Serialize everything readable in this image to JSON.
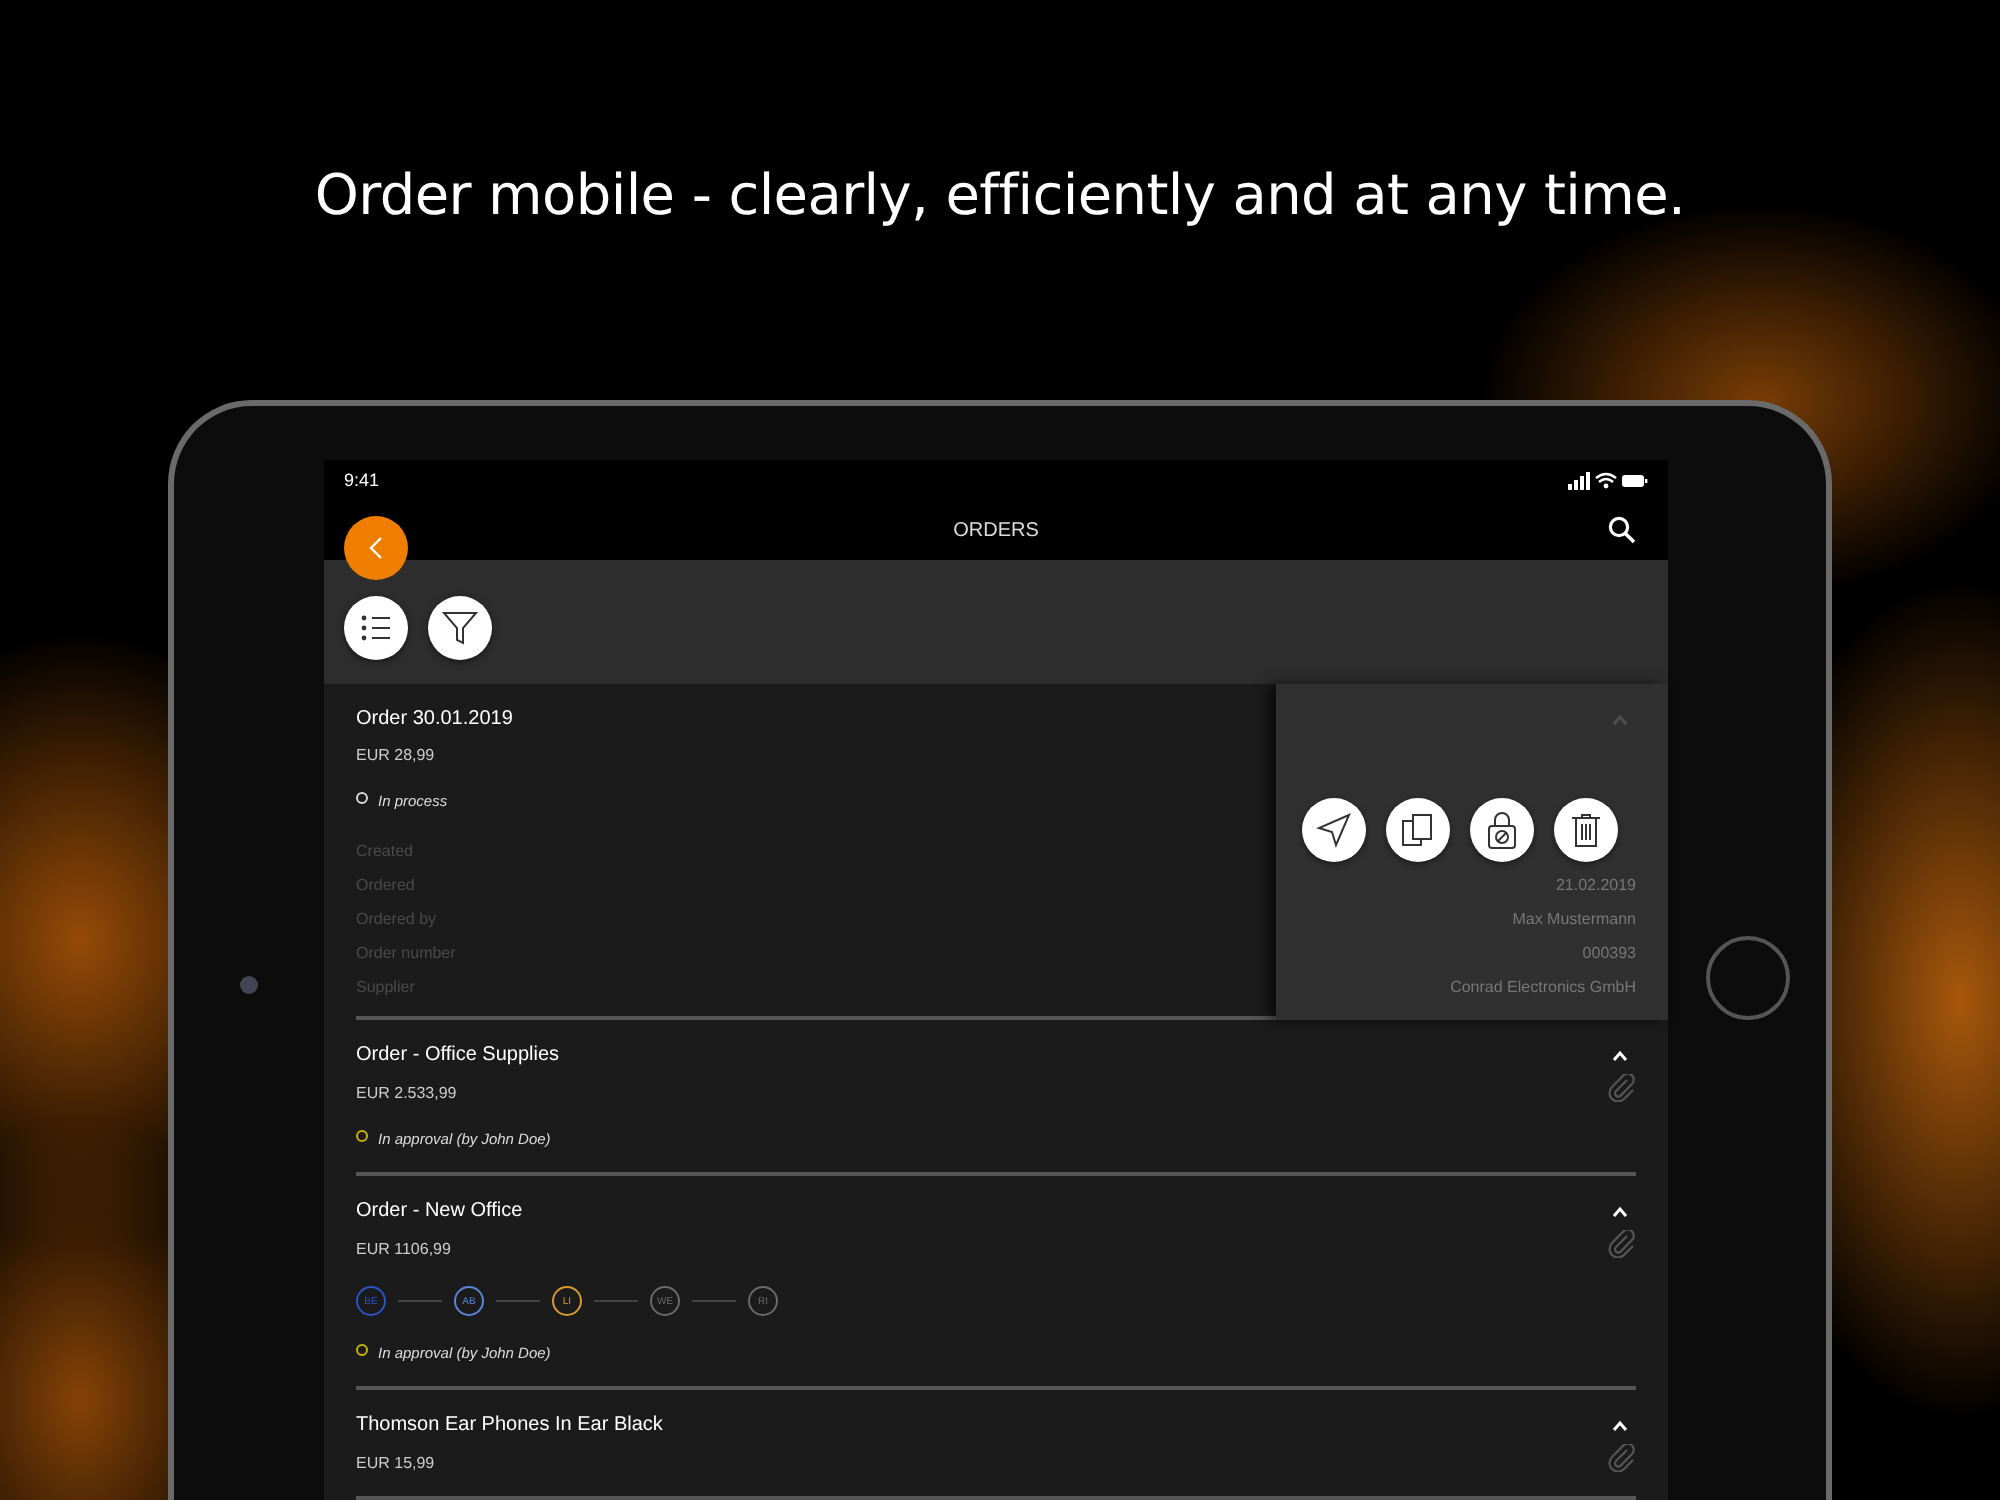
{
  "headline": "Order mobile - clearly, efficiently and at any time.",
  "status_bar": {
    "time": "9:41"
  },
  "nav": {
    "title": "ORDERS"
  },
  "orders": [
    {
      "title": "Order 30.01.2019",
      "amount": "EUR 28,99",
      "status": {
        "text": "In process",
        "color": "#d8d8d8"
      },
      "expanded": true,
      "swiped": true,
      "details": [
        {
          "label": "Created"
        },
        {
          "label": "Ordered",
          "value": "21.02.2019"
        },
        {
          "label": "Ordered by",
          "value": "Max Mustermann"
        },
        {
          "label": "Order number",
          "value": "000393"
        },
        {
          "label": "Supplier",
          "value": "Conrad Electronics GmbH"
        }
      ]
    },
    {
      "title": "Order - Office Supplies",
      "amount": "EUR 2.533,99",
      "status": {
        "text": "In approval (by John Doe)",
        "color": "#c9b400"
      },
      "expanded": true,
      "attachment": true,
      "swiped": false
    },
    {
      "title": "Order - New Office",
      "amount": "EUR 1106,99",
      "status": {
        "text": "In approval (by John Doe)",
        "color": "#c9b400"
      },
      "expanded": true,
      "attachment": true,
      "swiped": false,
      "steps": [
        {
          "label": "BE",
          "color": "#2a55c8"
        },
        {
          "label": "AB",
          "color": "#5a86d8"
        },
        {
          "label": "LI",
          "color": "#d99a2b"
        },
        {
          "label": "WE",
          "color": "#6a6a6a"
        },
        {
          "label": "RI",
          "color": "#6a6a6a"
        }
      ]
    },
    {
      "title": "Thomson Ear Phones In Ear Black",
      "amount": "EUR 15,99",
      "expanded": true,
      "attachment": true,
      "swiped": false
    }
  ]
}
